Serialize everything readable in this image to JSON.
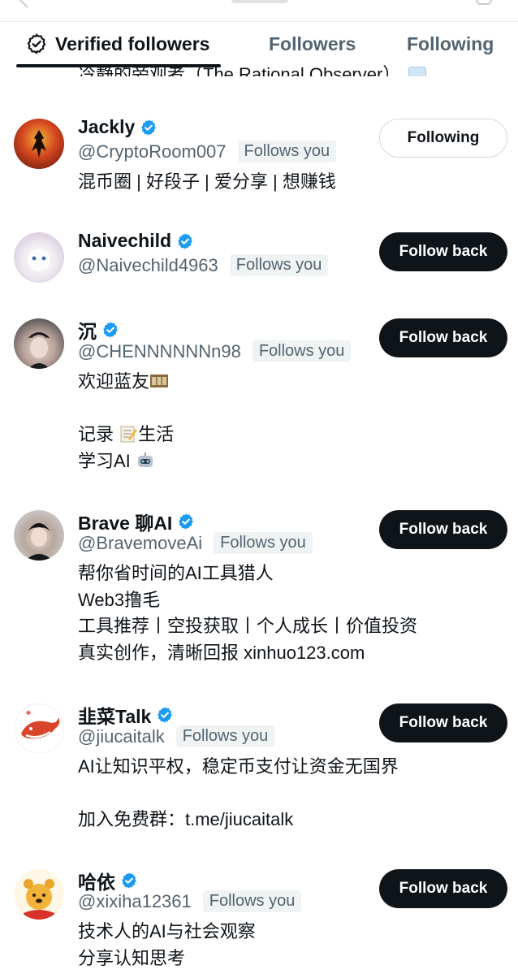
{
  "tabs": [
    {
      "label": "Verified followers",
      "active": true,
      "icon": "verified-check-icon"
    },
    {
      "label": "Followers",
      "active": false
    },
    {
      "label": "Following",
      "active": false
    }
  ],
  "cutoff_bio": "冷静的旁观者（The Rational Observer）",
  "colors": {
    "text": "#0f1419",
    "muted": "#536471",
    "verified": "#1d9bf0",
    "button_dark": "#0f1419",
    "pill_bg": "#eff3f4"
  },
  "users": [
    {
      "name": "Jackly",
      "handle": "@CryptoRoom007",
      "follows_you": "Follows you",
      "bio": [
        "混币圈 | 好段子 | 爱分享 | 想赚钱"
      ],
      "button": "Following"
    },
    {
      "name": "Naivechild",
      "handle": "@Naivechild4963",
      "follows_you": "Follows you",
      "bio": [],
      "button": "Follow back"
    },
    {
      "name": "沉",
      "handle": "@CHENNNNNNn98",
      "follows_you": "Follows you",
      "bio": [
        "欢迎蓝友",
        "",
        "记录",
        "学习AI"
      ],
      "bio_emoji": [
        "film-frames-icon",
        "memo-icon",
        "robot-icon"
      ],
      "bio_suffix": "生活",
      "button": "Follow back"
    },
    {
      "name": "Brave 聊AI",
      "handle": "@BravemoveAi",
      "follows_you": "Follows you",
      "bio": [
        "帮你省时间的AI工具猎人",
        "Web3撸毛",
        "工具推荐丨空投获取丨个人成长丨价值投资",
        "真实创作，清晰回报 xinhuo123.com"
      ],
      "button": "Follow back"
    },
    {
      "name": "韭菜Talk",
      "handle": "@jiucaitalk",
      "follows_you": "Follows you",
      "bio": [
        "AI让知识平权，稳定币支付让资金无国界",
        "",
        "加入免费群：t.me/jiucaitalk"
      ],
      "button": "Follow back"
    },
    {
      "name": "哈依",
      "handle": "@xixiha12361",
      "follows_you": "Follows you",
      "bio": [
        "技术人的AI与社会观察",
        "分享认知思考"
      ],
      "button": "Follow back"
    }
  ]
}
